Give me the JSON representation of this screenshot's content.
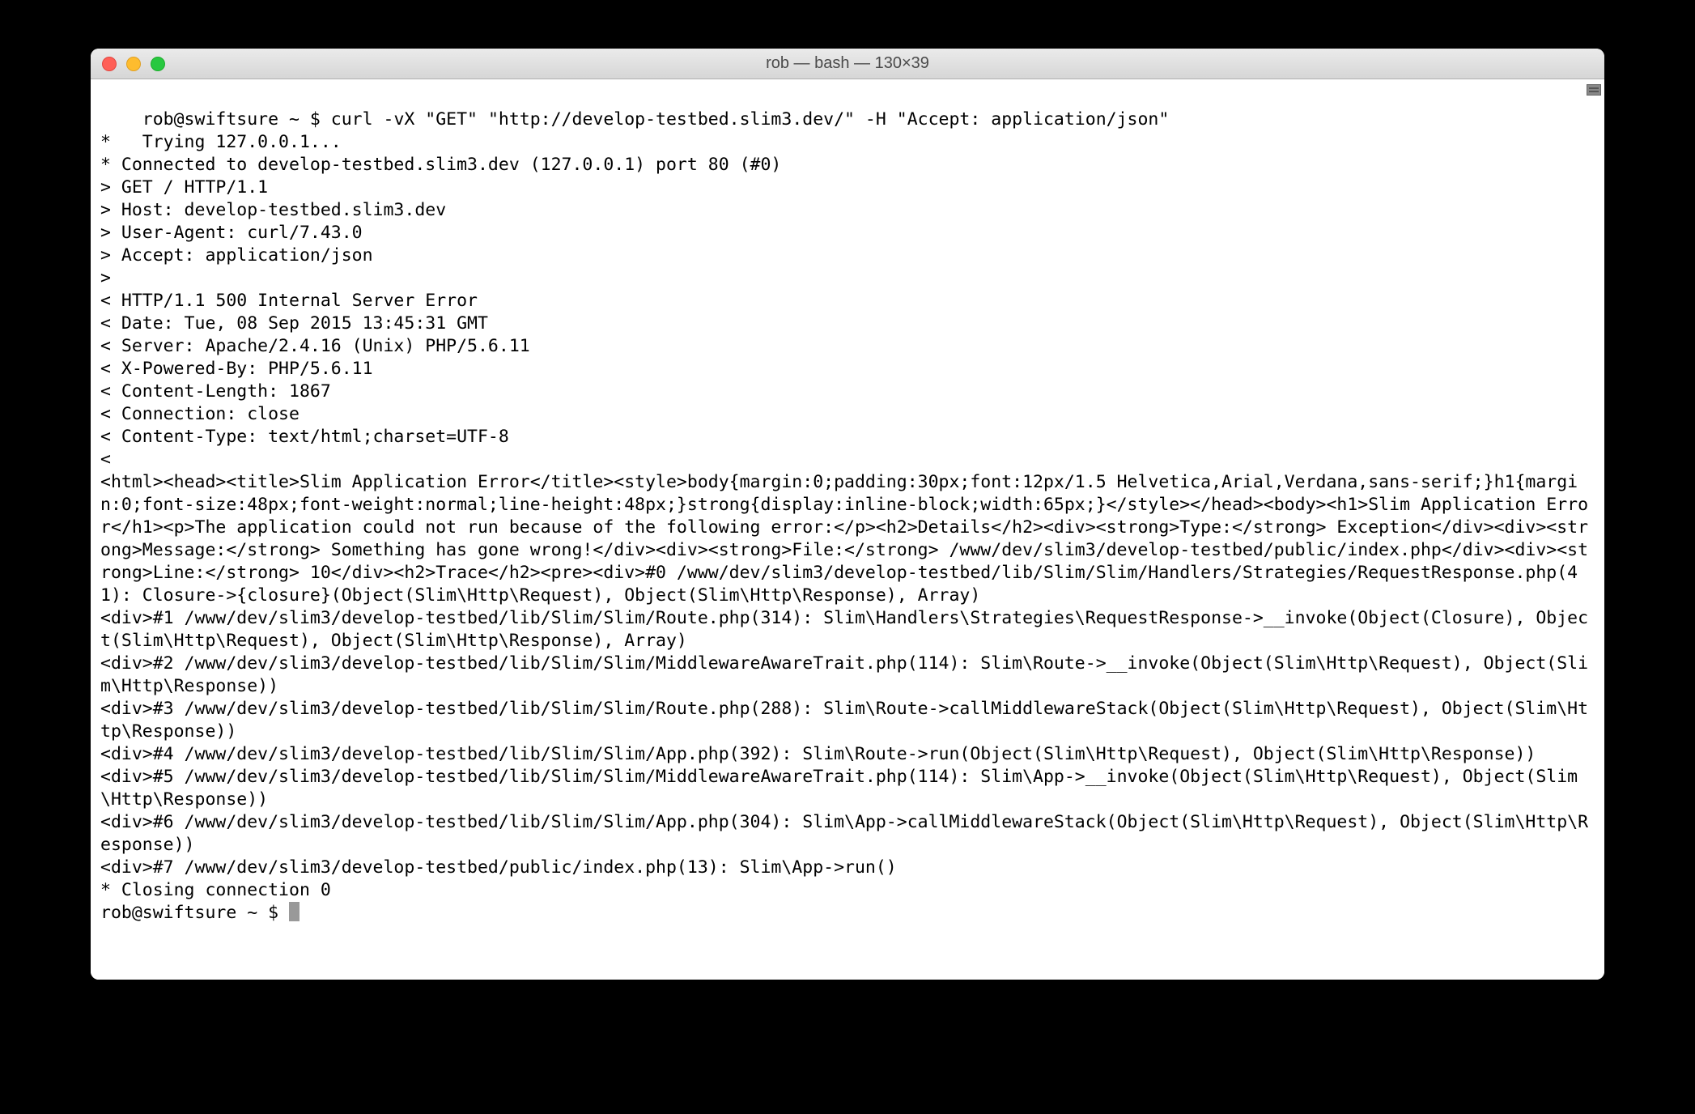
{
  "window": {
    "title": "rob — bash — 130×39"
  },
  "terminal": {
    "prompt": "rob@swiftsure ~ $ ",
    "command": "curl -vX \"GET\" \"http://develop-testbed.slim3.dev/\" -H \"Accept: application/json\"",
    "lines": [
      "*   Trying 127.0.0.1...",
      "* Connected to develop-testbed.slim3.dev (127.0.0.1) port 80 (#0)",
      "> GET / HTTP/1.1",
      "> Host: develop-testbed.slim3.dev",
      "> User-Agent: curl/7.43.0",
      "> Accept: application/json",
      ">",
      "< HTTP/1.1 500 Internal Server Error",
      "< Date: Tue, 08 Sep 2015 13:45:31 GMT",
      "< Server: Apache/2.4.16 (Unix) PHP/5.6.11",
      "< X-Powered-By: PHP/5.6.11",
      "< Content-Length: 1867",
      "< Connection: close",
      "< Content-Type: text/html;charset=UTF-8",
      "<",
      "<html><head><title>Slim Application Error</title><style>body{margin:0;padding:30px;font:12px/1.5 Helvetica,Arial,Verdana,sans-serif;}h1{margin:0;font-size:48px;font-weight:normal;line-height:48px;}strong{display:inline-block;width:65px;}</style></head><body><h1>Slim Application Error</h1><p>The application could not run because of the following error:</p><h2>Details</h2><div><strong>Type:</strong> Exception</div><div><strong>Message:</strong> Something has gone wrong!</div><div><strong>File:</strong> /www/dev/slim3/develop-testbed/public/index.php</div><div><strong>Line:</strong> 10</div><h2>Trace</h2><pre><div>#0 /www/dev/slim3/develop-testbed/lib/Slim/Slim/Handlers/Strategies/RequestResponse.php(41): Closure->{closure}(Object(Slim\\Http\\Request), Object(Slim\\Http\\Response), Array)",
      "<div>#1 /www/dev/slim3/develop-testbed/lib/Slim/Slim/Route.php(314): Slim\\Handlers\\Strategies\\RequestResponse->__invoke(Object(Closure), Object(Slim\\Http\\Request), Object(Slim\\Http\\Response), Array)",
      "<div>#2 /www/dev/slim3/develop-testbed/lib/Slim/Slim/MiddlewareAwareTrait.php(114): Slim\\Route->__invoke(Object(Slim\\Http\\Request), Object(Slim\\Http\\Response))",
      "<div>#3 /www/dev/slim3/develop-testbed/lib/Slim/Slim/Route.php(288): Slim\\Route->callMiddlewareStack(Object(Slim\\Http\\Request), Object(Slim\\Http\\Response))",
      "<div>#4 /www/dev/slim3/develop-testbed/lib/Slim/Slim/App.php(392): Slim\\Route->run(Object(Slim\\Http\\Request), Object(Slim\\Http\\Response))",
      "<div>#5 /www/dev/slim3/develop-testbed/lib/Slim/Slim/MiddlewareAwareTrait.php(114): Slim\\App->__invoke(Object(Slim\\Http\\Request), Object(Slim\\Http\\Response))",
      "<div>#6 /www/dev/slim3/develop-testbed/lib/Slim/Slim/App.php(304): Slim\\App->callMiddlewareStack(Object(Slim\\Http\\Request), Object(Slim\\Http\\Response))",
      "<div>#7 /www/dev/slim3/develop-testbed/public/index.php(13): Slim\\App->run()",
      "* Closing connection 0"
    ],
    "prompt2": "rob@swiftsure ~ $ "
  }
}
